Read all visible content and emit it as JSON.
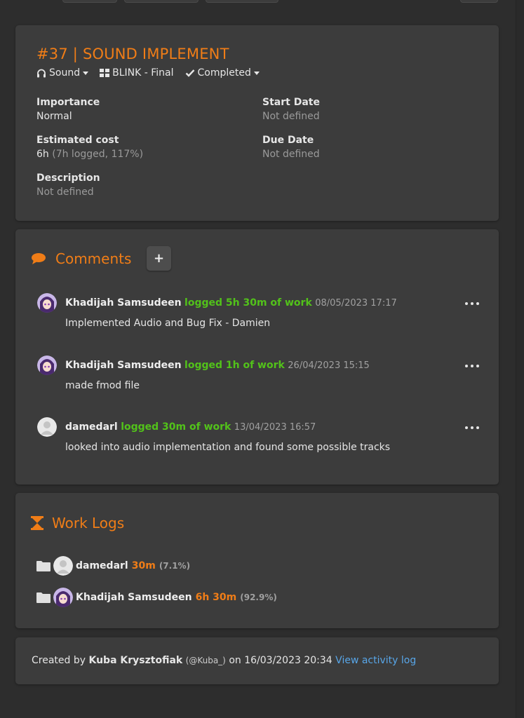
{
  "task": {
    "title": "#37 | SOUND IMPLEMENT",
    "category": "Sound",
    "board": "BLINK - Final",
    "status": "Completed",
    "importance_label": "Importance",
    "importance_value": "Normal",
    "start_label": "Start Date",
    "start_value": "Not defined",
    "cost_label": "Estimated cost",
    "cost_value": "6h",
    "cost_sub": "(7h logged, 117%)",
    "due_label": "Due Date",
    "due_value": "Not defined",
    "desc_label": "Description",
    "desc_value": "Not defined"
  },
  "comments": {
    "title": "Comments",
    "add_label": "+",
    "items": [
      {
        "author": "Khadijah Samsudeen",
        "logged": "logged 5h 30m of work",
        "timestamp": "08/05/2023 17:17",
        "text": "Implemented Audio and Bug Fix - Damien",
        "avatar": "anime-avatar"
      },
      {
        "author": "Khadijah Samsudeen",
        "logged": "logged 1h of work",
        "timestamp": "26/04/2023 15:15",
        "text": "made fmod file",
        "avatar": "anime-avatar"
      },
      {
        "author": "damedarl",
        "logged": "logged 30m of work",
        "timestamp": "13/04/2023 16:57",
        "text": "looked into audio implementation and found some possible tracks",
        "avatar": "default-avatar"
      }
    ]
  },
  "worklogs": {
    "title": "Work Logs",
    "items": [
      {
        "name": "damedarl",
        "duration": "30m",
        "percent": "(7.1%)",
        "avatar": "default-avatar"
      },
      {
        "name": "Khadijah Samsudeen",
        "duration": "6h 30m",
        "percent": "(92.9%)",
        "avatar": "anime-avatar"
      }
    ]
  },
  "footer": {
    "created_by": "Created by",
    "creator": "Kuba Krysztofiak",
    "handle": "(@Kuba_)",
    "on_text": "on 16/03/2023 20:34",
    "activity_link": "View activity log"
  },
  "colors": {
    "accent": "#f07d17",
    "logged_green": "#52c21a",
    "link_blue": "#58a6e8",
    "panel_bg": "#3c3c3c",
    "page_bg": "#2d2d2d"
  }
}
